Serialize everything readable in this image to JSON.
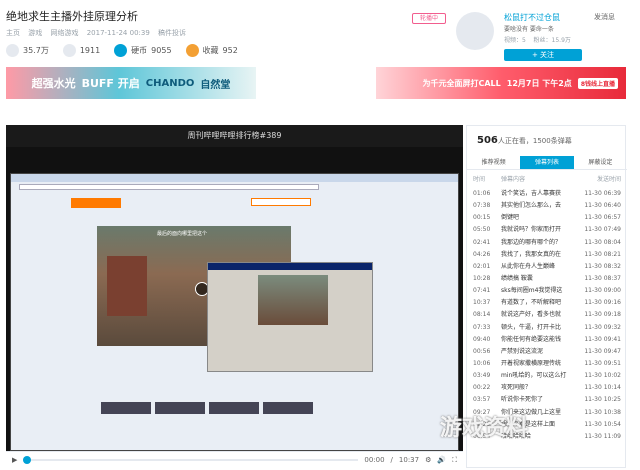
{
  "video": {
    "title": "绝地求生主播外挂原理分析",
    "date": "2017-11-24 00:39",
    "copyright": "稿件投诉",
    "breadcrumb": [
      "主页",
      "游戏",
      "网络游戏"
    ],
    "plays": "35.7万",
    "danmaku_count": "1911",
    "coins_label": "硬币",
    "coins": "9055",
    "fav_label": "收藏",
    "favorites": "952"
  },
  "uploader": {
    "report_label": "轮播中",
    "name": "松鼠打不过仓鼠",
    "desc": "要啥没有 要命一条",
    "videos_label": "视频",
    "videos": "5",
    "fans_label": "粉丝",
    "fans": "15.9万",
    "message_label": "发消息",
    "follow_label": "+ 关注"
  },
  "ads": {
    "left_main": "超强水光",
    "left_sub": "BUFF 开启",
    "left_brand": "CHANDO",
    "left_brand2": "自然堂",
    "right_text": "为千元全面屏打CALL",
    "right_date": "12月7日 下午2点",
    "right_tag": "8钱线上直播"
  },
  "player": {
    "overlay_title": "周刊哔哩哔哩排行榜#389",
    "danmaku_line1": "最后的面向哪里把这个",
    "time_current": "00:00",
    "time_total": "10:37",
    "time_sep": " / "
  },
  "sidebar": {
    "viewers": "506",
    "viewers_suffix": "人正在看，1500条弹幕",
    "tabs": [
      "推荐视频",
      "弹幕列表",
      "屏蔽设定"
    ],
    "columns": [
      "时间",
      "弹幕内容",
      "发送时间"
    ],
    "rows": [
      {
        "t": "01:06",
        "c": "说个笑话，吉人靠赛获",
        "s": "11-30 06:39"
      },
      {
        "t": "07:38",
        "c": "其实他们怎么那么，去",
        "s": "11-30 06:40"
      },
      {
        "t": "00:15",
        "c": "倒键吧",
        "s": "11-30 06:57"
      },
      {
        "t": "05:50",
        "c": "我就说吗？你家而打开",
        "s": "11-30 07:49"
      },
      {
        "t": "02:41",
        "c": "我那边的哪有哪个的？",
        "s": "11-30 08:04"
      },
      {
        "t": "04:26",
        "c": "我找了，我那女真的在",
        "s": "11-30 08:21"
      },
      {
        "t": "02:01",
        "c": "从此你在舟人生巅峰",
        "s": "11-30 08:32"
      },
      {
        "t": "10:28",
        "c": "绩绩搞 鞍囊",
        "s": "11-30 08:37"
      },
      {
        "t": "07:41",
        "c": "sks每间圈m4我觉得这",
        "s": "11-30 09:00"
      },
      {
        "t": "10:37",
        "c": "有道数了，不听解释吧",
        "s": "11-30 09:16"
      },
      {
        "t": "08:14",
        "c": "就说这产好，看多也就",
        "s": "11-30 09:18"
      },
      {
        "t": "07:33",
        "c": "顿头，牛逼，打开卡比",
        "s": "11-30 09:32"
      },
      {
        "t": "09:40",
        "c": "你能任何有绝要这能钱",
        "s": "11-30 09:41"
      },
      {
        "t": "00:56",
        "c": "严禁别说这流泥",
        "s": "11-30 09:47"
      },
      {
        "t": "10:06",
        "c": "开着视家撒横原理传统",
        "s": "11-30 09:51"
      },
      {
        "t": "03:49",
        "c": "min吼给的，可以这么打",
        "s": "11-30 10:02"
      },
      {
        "t": "00:22",
        "c": "攻死同般？",
        "s": "11-30 10:14"
      },
      {
        "t": "03:57",
        "c": "听说你卡死你了",
        "s": "11-30 10:25"
      },
      {
        "t": "09:27",
        "c": "你们来这边做几上这里",
        "s": "11-30 10:38"
      },
      {
        "t": "01:29",
        "c": "想起来都是这样上面",
        "s": "11-30 10:54"
      },
      {
        "t": "00:54",
        "c": "哈哈哈哈哈",
        "s": "11-30 11:09"
      }
    ]
  },
  "watermark": "游戏资料"
}
